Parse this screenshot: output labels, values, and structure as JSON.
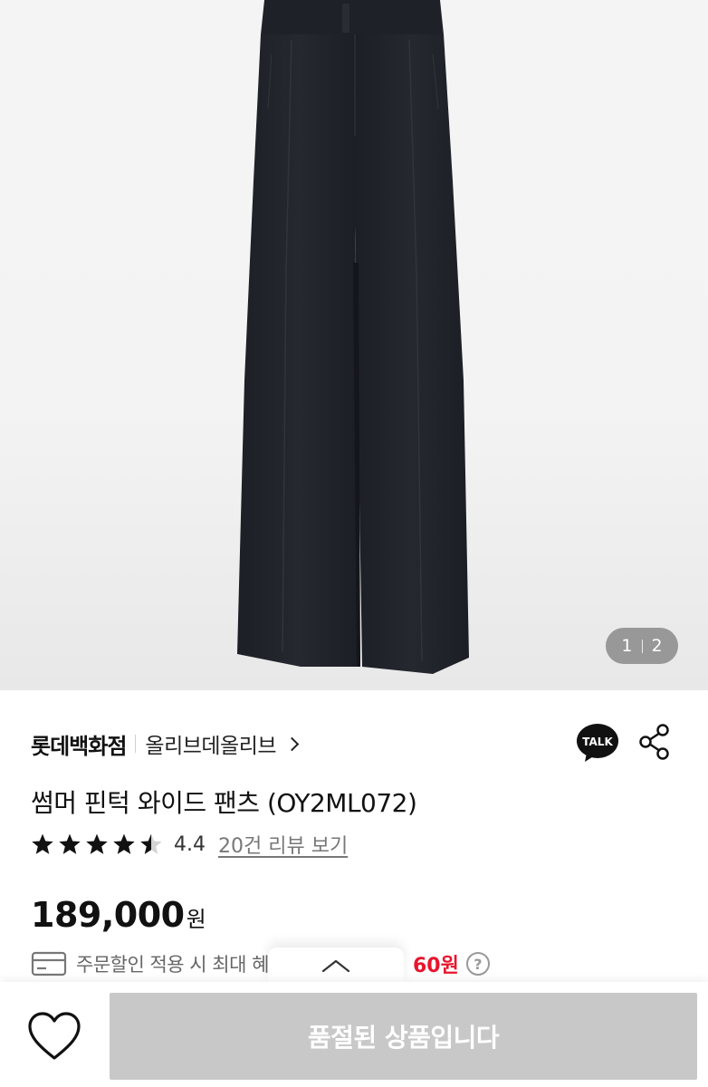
{
  "gallery": {
    "current": "1",
    "total": "2"
  },
  "product": {
    "brand": "롯데백화점",
    "shop_name": "올리브데올리브",
    "title": "썸머 핀턱 와이드 팬츠 (OY2ML072)",
    "rating": "4.4",
    "rating_value": 4.4,
    "review_link": "20건 리뷰 보기",
    "price": "189,000",
    "currency": "원"
  },
  "benefit": {
    "text": "주문할인 적용 시 최대 혜",
    "amount": "60원"
  },
  "icons": {
    "talk": "TALK",
    "help": "?"
  },
  "bottom_bar": {
    "soldout_label": "품절된 상품입니다"
  },
  "colors": {
    "accent_red": "#e8152d",
    "disabled_button": "#c8c8c8",
    "pants": "#22242b"
  }
}
